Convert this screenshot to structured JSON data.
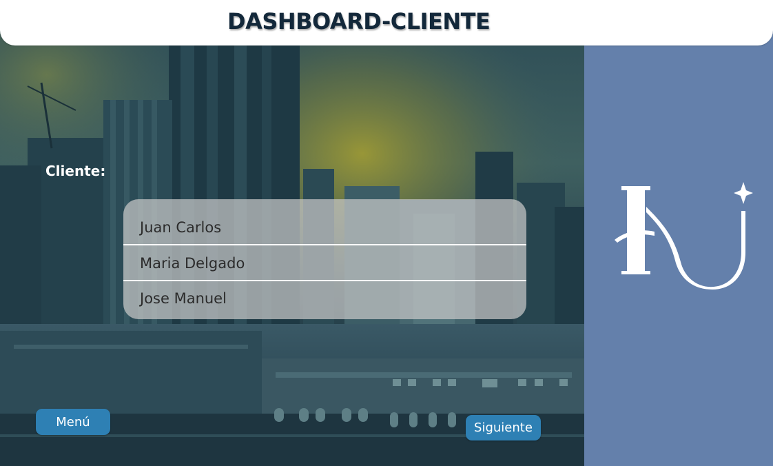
{
  "header": {
    "title": "DASHBOARD-CLIENTE"
  },
  "form": {
    "client_label": "Cliente:",
    "clients": [
      {
        "name": "Juan Carlos"
      },
      {
        "name": "Maria Delgado"
      },
      {
        "name": "Jose Manuel"
      }
    ]
  },
  "buttons": {
    "menu_label": "Menú",
    "next_label": "Siguiente"
  },
  "colors": {
    "side_panel": "#6480ab",
    "button": "#2e80b4",
    "title": "#13283a"
  },
  "icons": {
    "logo": "hu-monogram-logo"
  }
}
